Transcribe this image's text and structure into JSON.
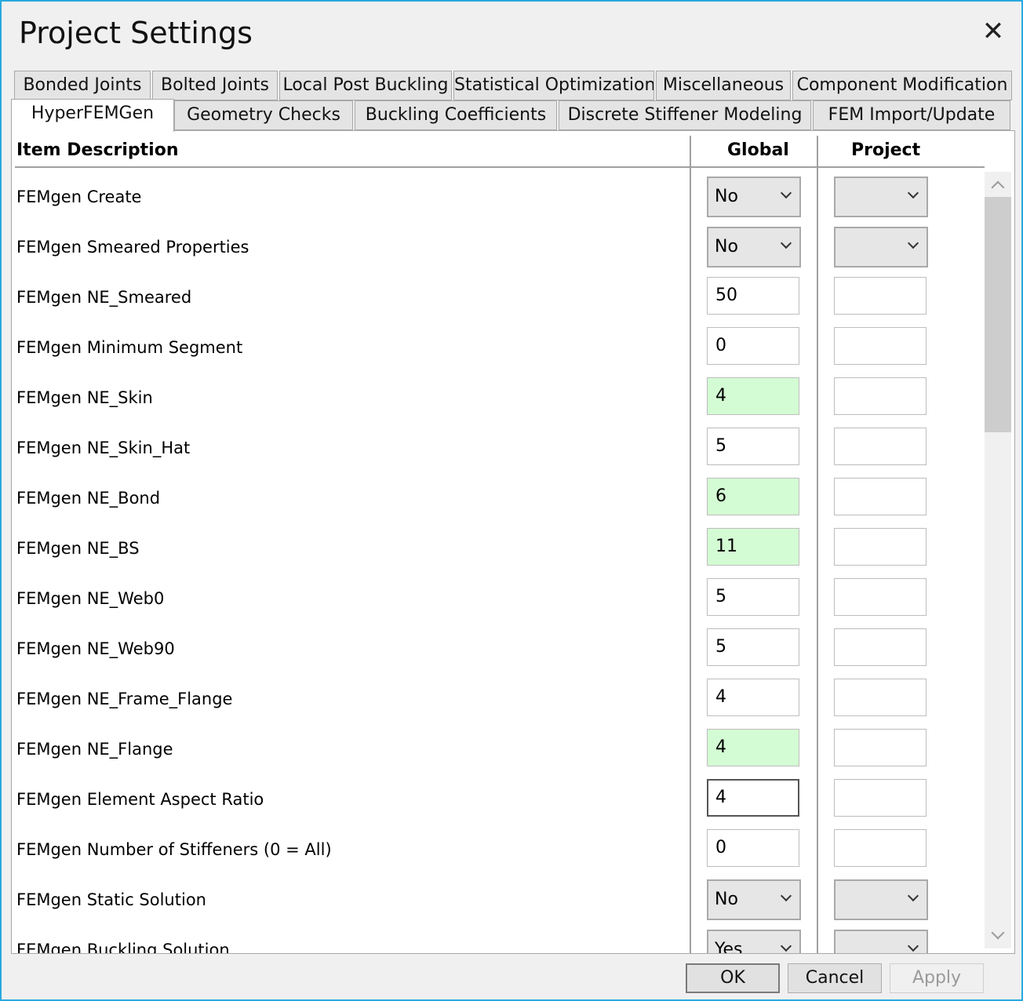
{
  "window": {
    "title": "Project Settings",
    "close_label": "✕"
  },
  "tabs_row1": [
    {
      "label": "Bonded Joints"
    },
    {
      "label": "Bolted Joints"
    },
    {
      "label": "Local Post Buckling"
    },
    {
      "label": "Statistical Optimization"
    },
    {
      "label": "Miscellaneous"
    },
    {
      "label": "Component Modification"
    }
  ],
  "tabs_row2": [
    {
      "label": "HyperFEMGen",
      "active": true
    },
    {
      "label": "Geometry Checks"
    },
    {
      "label": "Buckling Coefficients"
    },
    {
      "label": "Discrete Stiffener Modeling"
    },
    {
      "label": "FEM Import/Update"
    }
  ],
  "table": {
    "headers": {
      "description": "Item Description",
      "global": "Global",
      "project": "Project"
    },
    "rows": [
      {
        "desc": "FEMgen Create",
        "type": "select",
        "global": "No",
        "project": ""
      },
      {
        "desc": "FEMgen Smeared Properties",
        "type": "select",
        "global": "No",
        "project": ""
      },
      {
        "desc": "FEMgen NE_Smeared",
        "type": "text",
        "global": "50",
        "project": ""
      },
      {
        "desc": "FEMgen Minimum Segment",
        "type": "text",
        "global": "0",
        "project": ""
      },
      {
        "desc": "FEMgen NE_Skin",
        "type": "text",
        "global": "4",
        "project": "",
        "highlight": true
      },
      {
        "desc": "FEMgen NE_Skin_Hat",
        "type": "text",
        "global": "5",
        "project": ""
      },
      {
        "desc": "FEMgen NE_Bond",
        "type": "text",
        "global": "6",
        "project": "",
        "highlight": true
      },
      {
        "desc": "FEMgen NE_BS",
        "type": "text",
        "global": "11",
        "project": "",
        "highlight": true
      },
      {
        "desc": "FEMgen NE_Web0",
        "type": "text",
        "global": "5",
        "project": ""
      },
      {
        "desc": "FEMgen NE_Web90",
        "type": "text",
        "global": "5",
        "project": ""
      },
      {
        "desc": "FEMgen NE_Frame_Flange",
        "type": "text",
        "global": "4",
        "project": ""
      },
      {
        "desc": "FEMgen NE_Flange",
        "type": "text",
        "global": "4",
        "project": "",
        "highlight": true
      },
      {
        "desc": "FEMgen Element Aspect Ratio",
        "type": "text",
        "global": "4",
        "project": "",
        "focused": true
      },
      {
        "desc": "FEMgen Number of Stiffeners (0 = All)",
        "type": "text",
        "global": "0",
        "project": ""
      },
      {
        "desc": "FEMgen Static Solution",
        "type": "select",
        "global": "No",
        "project": ""
      },
      {
        "desc": "FEMgen Buckling Solution",
        "type": "select",
        "global": "Yes",
        "project": ""
      }
    ]
  },
  "buttons": {
    "ok": "OK",
    "cancel": "Cancel",
    "apply": "Apply"
  },
  "colors": {
    "highlight": "#d4fcd4",
    "window_border": "#2aa9e0"
  }
}
